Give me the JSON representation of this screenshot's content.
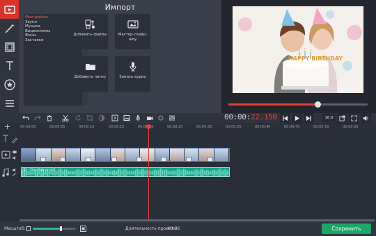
{
  "import": {
    "title": "Импорт",
    "categories": [
      "Мои файлы",
      "Звуки",
      "Музыка",
      "Видеоклипы",
      "Фоны",
      "Заставки"
    ],
    "tiles": [
      {
        "label": "Добавить файлы",
        "icon": "add-files-icon"
      },
      {
        "label": "Мастер слайд-шоу",
        "icon": "slideshow-wizard-icon"
      },
      {
        "label": "Добавить папку",
        "icon": "folder-icon"
      },
      {
        "label": "Запись аудио",
        "icon": "microphone-icon"
      }
    ],
    "collapse": "‹"
  },
  "preview": {
    "progress": 0.64
  },
  "timecode": {
    "current": "00:00:",
    "total": "22.150"
  },
  "aspect_ratio": "16:9",
  "timeline": {
    "add": "+",
    "ticks": [
      "00:00:00",
      "00:00:05",
      "00:00:10",
      "00:00:15",
      "00:00:20",
      "00:00:25",
      "00:00:30",
      "00:00:35",
      "00:00:40",
      "00:00:45",
      "00:00:50",
      "00:00:55"
    ],
    "audio_clip": "3] - Our Story.mp3"
  },
  "status": {
    "zoom_label": "Масштаб:",
    "zoom_level": 0.65,
    "duration_label": "Длительность проекта:",
    "duration": "00:36",
    "save": "Сохранить"
  },
  "colors": {
    "accent": "#e3403a",
    "save": "#1aa768",
    "audio": "#1ca38b",
    "zoom": "#2bbd8e"
  }
}
